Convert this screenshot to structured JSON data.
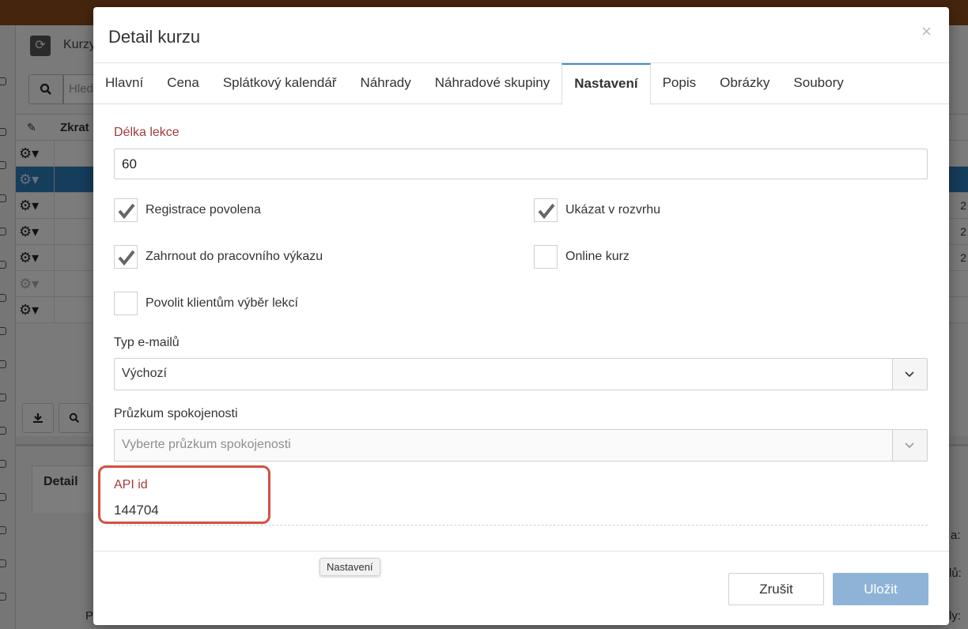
{
  "background": {
    "page_title": "Kurzy",
    "search_placeholder": "Hled",
    "table_header": "Zkrat",
    "row_edge_value": "2",
    "detail_tab": "Detail",
    "frag_a": "a:",
    "frag_b": "lů:",
    "frag_c": "ly:",
    "frag_p": "P"
  },
  "modal": {
    "title": "Detail kurzu",
    "close_icon": "×",
    "tabs": [
      {
        "label": "Hlavní"
      },
      {
        "label": "Cena"
      },
      {
        "label": "Splátkový kalendář"
      },
      {
        "label": "Náhrady"
      },
      {
        "label": "Náhradové skupiny"
      },
      {
        "label": "Nastavení",
        "active": true
      },
      {
        "label": "Popis"
      },
      {
        "label": "Obrázky"
      },
      {
        "label": "Soubory"
      }
    ],
    "settings": {
      "lesson_length_label": "Délka lekce",
      "lesson_length_value": "60",
      "registration_allowed": {
        "label": "Registrace povolena",
        "checked": true
      },
      "show_in_schedule": {
        "label": "Ukázat v rozvrhu",
        "checked": true
      },
      "include_in_report": {
        "label": "Zahrnout do pracovního výkazu",
        "checked": true
      },
      "online_course": {
        "label": "Online kurz",
        "checked": false
      },
      "allow_lesson_choice": {
        "label": "Povolit klientům výběr lekcí",
        "checked": false
      },
      "email_type_label": "Typ e-mailů",
      "email_type_value": "Výchozí",
      "survey_label": "Průzkum spokojenosti",
      "survey_placeholder": "Vyberte průzkum spokojenosti",
      "api_id_label": "API id",
      "api_id_value": "144704"
    },
    "tooltip": "Nastavení",
    "cancel_label": "Zrušit",
    "save_label": "Uložit"
  },
  "colors": {
    "required_label": "#a33a3a",
    "highlight_box": "#d3513e",
    "save_button": "#8fb3d7",
    "active_tab_border": "#4a8cc9",
    "selected_row": "#2a7ab8"
  }
}
